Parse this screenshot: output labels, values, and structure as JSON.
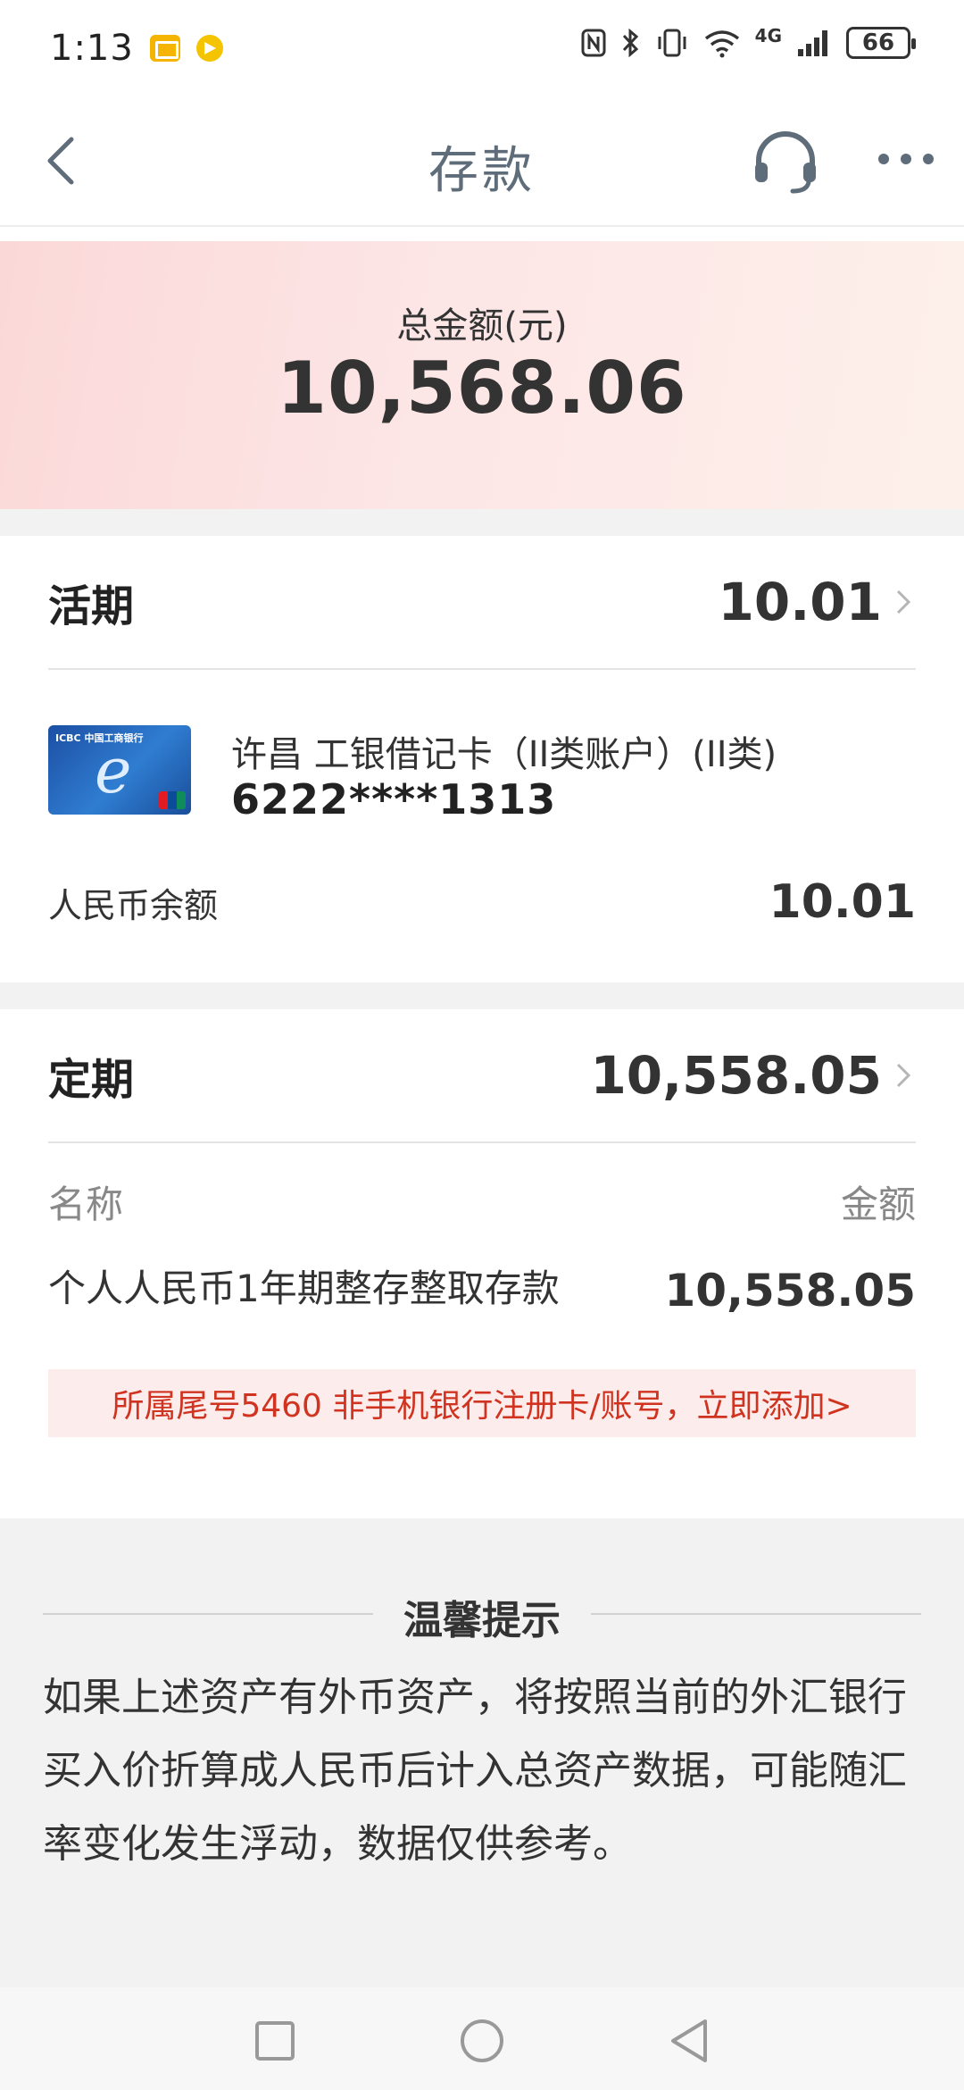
{
  "status_bar": {
    "time": "1:13",
    "network": "4G",
    "battery": "66"
  },
  "nav": {
    "title": "存款"
  },
  "summary": {
    "label": "总金额(元)",
    "amount": "10,568.06"
  },
  "current": {
    "title": "活期",
    "total": "10.01",
    "card": {
      "name": "许昌 工银借记卡（II类账户）(II类)",
      "number": "6222****1313",
      "bank_logo_text": "ICBC 中国工商银行"
    },
    "balance_label": "人民币余额",
    "balance_value": "10.01"
  },
  "fixed": {
    "title": "定期",
    "total": "10,558.05",
    "col_name": "名称",
    "col_amount": "金额",
    "product_name": "个人人民币1年期整存整取存款",
    "product_amount": "10,558.05",
    "notice": "所属尾号5460 非手机银行注册卡/账号，立即添加>"
  },
  "tips": {
    "title": "温馨提示",
    "body": "如果上述资产有外币资产，将按照当前的外汇银行买入价折算成人民币后计入总资产数据，可能随汇率变化发生浮动，数据仅供参考。"
  },
  "colors": {
    "accent_red": "#d0331f",
    "notice_bg": "#fdecec",
    "banner_start": "#fbd8d8",
    "banner_end": "#fdf0ea"
  },
  "icons": {
    "back": "chevron-left-icon",
    "service": "headset-icon",
    "more": "more-dots-icon"
  }
}
